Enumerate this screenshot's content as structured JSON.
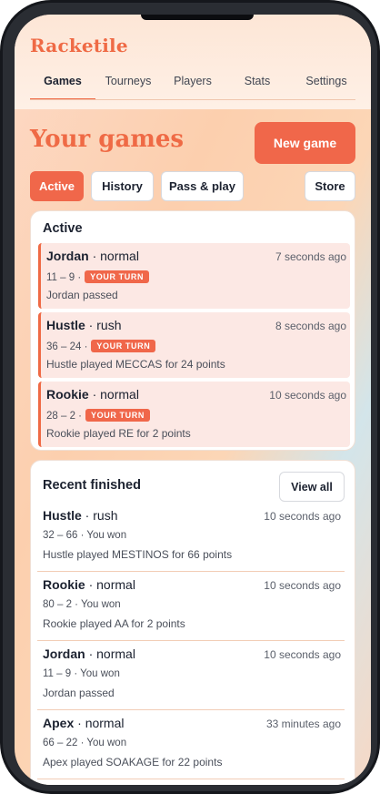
{
  "app": {
    "name": "Racketile"
  },
  "nav": {
    "tabs": [
      {
        "label": "Games",
        "active": true
      },
      {
        "label": "Tourneys"
      },
      {
        "label": "Players"
      },
      {
        "label": "Stats"
      },
      {
        "label": "Settings"
      }
    ]
  },
  "page": {
    "title": "Your games",
    "new_game_label": "New game"
  },
  "filters": {
    "active": "Active",
    "history": "History",
    "pass_play": "Pass & play",
    "store": "Store"
  },
  "active": {
    "title": "Active",
    "games": [
      {
        "name": "Jordan",
        "mode": "normal",
        "time": "7 seconds ago",
        "score": "11 – 9",
        "badge": "YOUR TURN",
        "desc": "Jordan passed"
      },
      {
        "name": "Hustle",
        "mode": "rush",
        "time": "8 seconds ago",
        "score": "36 – 24",
        "badge": "YOUR TURN",
        "desc": "Hustle played MECCAS for 24 points"
      },
      {
        "name": "Rookie",
        "mode": "normal",
        "time": "10 seconds ago",
        "score": "28 – 2",
        "badge": "YOUR TURN",
        "desc": "Rookie played RE for 2 points"
      }
    ]
  },
  "finished": {
    "title": "Recent finished",
    "view_all_label": "View all",
    "games": [
      {
        "name": "Hustle",
        "mode": "rush",
        "time": "10 seconds ago",
        "score": "32 – 66",
        "result": "You won",
        "desc": "Hustle played MESTINOS for 66 points"
      },
      {
        "name": "Rookie",
        "mode": "normal",
        "time": "10 seconds ago",
        "score": "80 – 2",
        "result": "You won",
        "desc": "Rookie played AA for 2 points"
      },
      {
        "name": "Jordan",
        "mode": "normal",
        "time": "10 seconds ago",
        "score": "11 – 9",
        "result": "You won",
        "desc": "Jordan passed"
      },
      {
        "name": "Apex",
        "mode": "normal",
        "time": "33 minutes ago",
        "score": "66 – 22",
        "result": "You won",
        "desc": "Apex played SOAKAGE for 22 points"
      }
    ]
  },
  "colors": {
    "accent": "#f0674a",
    "text": "#1c2230",
    "row_bg": "#fce8e4"
  }
}
